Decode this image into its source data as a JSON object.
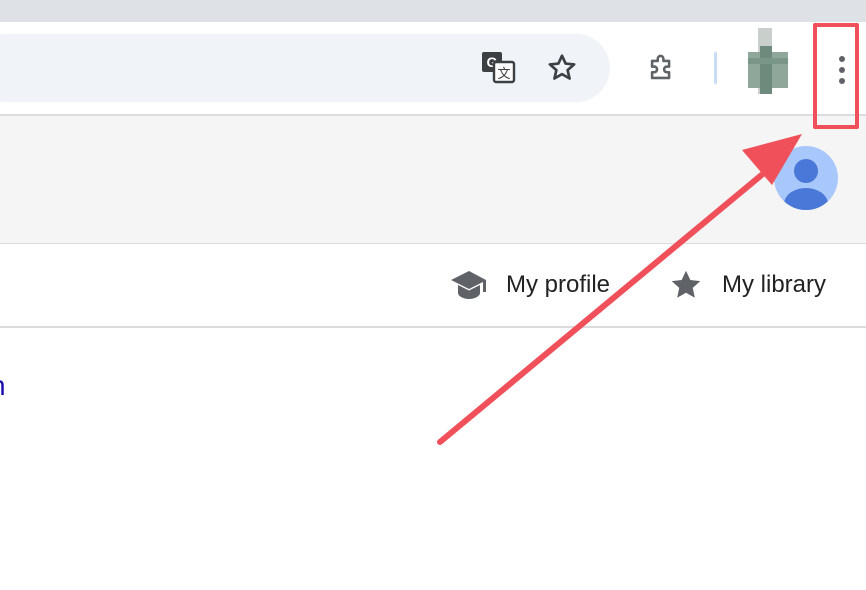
{
  "toolbar": {
    "translate_icon": "google-translate-icon",
    "bookmark_icon": "star-outline-icon",
    "extensions_icon": "puzzle-piece-icon",
    "menu_icon": "three-dot-vertical-icon"
  },
  "nav": {
    "profile_label": "My profile",
    "library_label": "My library"
  },
  "content": {
    "partial_link_text": "n"
  },
  "annotation": {
    "color": "#f0505a"
  },
  "colors": {
    "omnibox_bg": "#f0f4f9",
    "avatar_bg": "#a8c7fa",
    "avatar_fg": "#4a78d8",
    "link": "#1a0dab"
  }
}
